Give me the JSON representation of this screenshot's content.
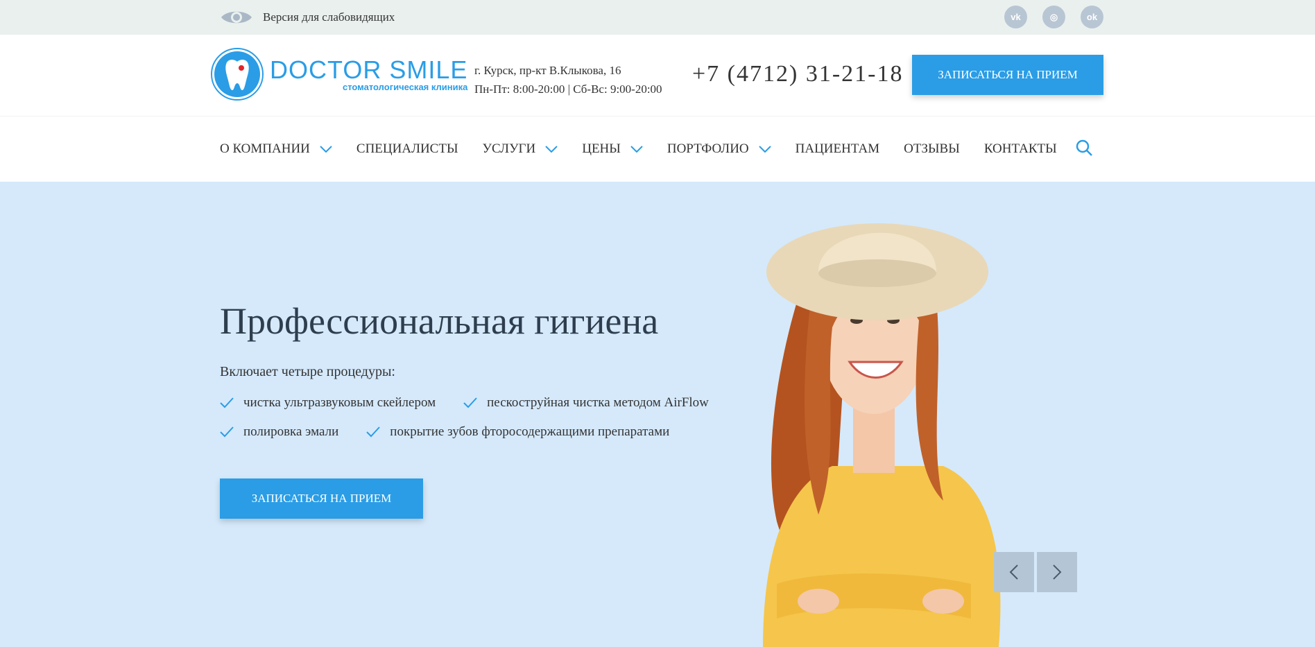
{
  "topbar": {
    "accessibility_label": "Версия для слабовидящих",
    "socials": [
      {
        "name": "vk-icon",
        "glyph": "vk"
      },
      {
        "name": "instagram-icon",
        "glyph": "◎"
      },
      {
        "name": "odnoklassniki-icon",
        "glyph": "ok"
      }
    ]
  },
  "header": {
    "logo_name": "DOCTOR SMILE",
    "logo_sub": "стоматологическая клиника",
    "address_line1": "г. Курск, пр-кт В.Клыкова, 16",
    "address_line2": "Пн-Пт: 8:00-20:00 | Сб-Вс: 9:00-20:00",
    "phone": "+7 (4712) 31-21-18",
    "cta_label": "ЗАПИСАТЬСЯ НА ПРИЕМ"
  },
  "nav": {
    "items": [
      {
        "label": "О КОМПАНИИ",
        "dropdown": true
      },
      {
        "label": "СПЕЦИАЛИСТЫ",
        "dropdown": false
      },
      {
        "label": "УСЛУГИ",
        "dropdown": true
      },
      {
        "label": "ЦЕНЫ",
        "dropdown": true
      },
      {
        "label": "ПОРТФОЛИО",
        "dropdown": true
      },
      {
        "label": "ПАЦИЕНТАМ",
        "dropdown": false
      },
      {
        "label": "ОТЗЫВЫ",
        "dropdown": false
      },
      {
        "label": "КОНТАКТЫ",
        "dropdown": false
      }
    ]
  },
  "hero": {
    "title": "Профессиональная гигиена",
    "lead": "Включает четыре процедуры:",
    "checks": [
      "чистка ультразвуковым скейлером",
      "пескоструйная чистка методом AirFlow",
      "полировка эмали",
      "покрытие зубов фторосодержащими препаратами"
    ],
    "cta_label": "ЗАПИСАТЬСЯ НА ПРИЕМ"
  },
  "colors": {
    "accent": "#2a9de6",
    "hero_bg": "#d5e9fb",
    "topbar_bg": "#e9f0ee",
    "arrow_bg": "#b4c6d6"
  }
}
